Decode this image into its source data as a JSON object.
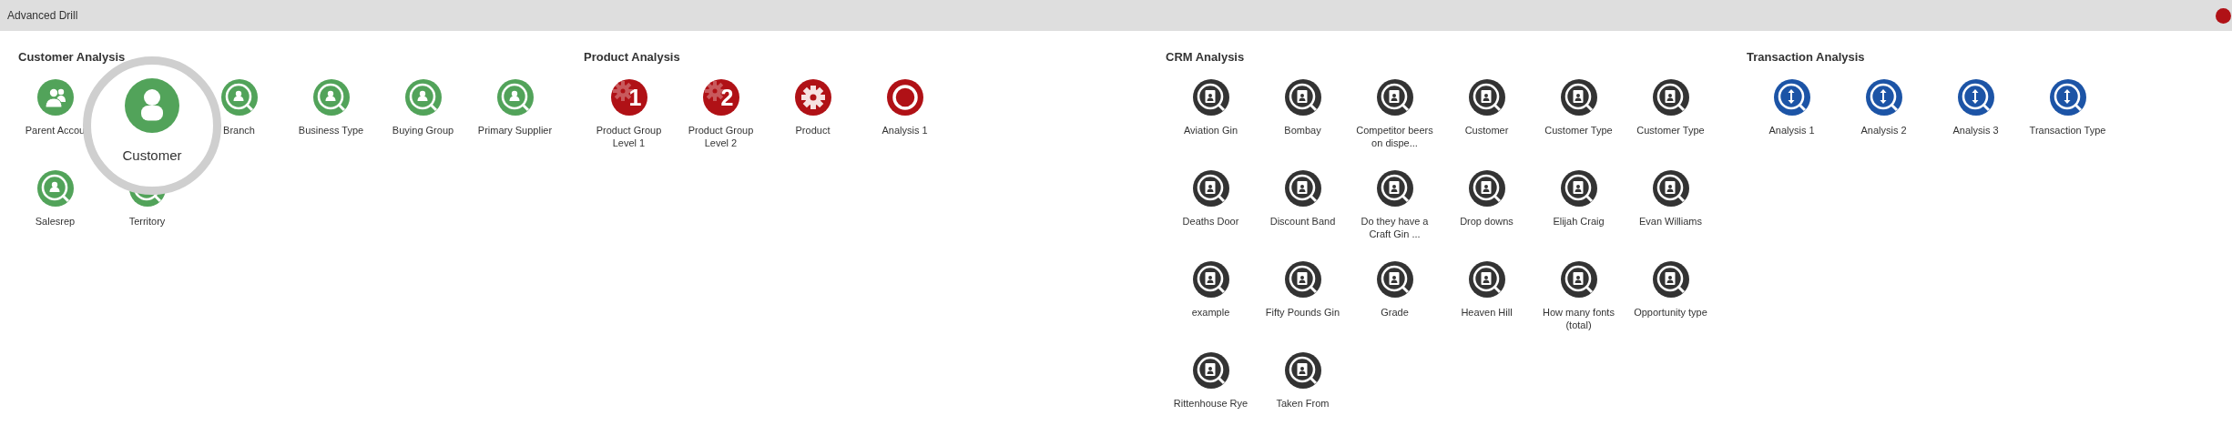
{
  "window": {
    "title": "Advanced Drill"
  },
  "sections": [
    {
      "title": "Customer Analysis",
      "color": "#52a35a",
      "items": [
        {
          "label": "Parent Accou",
          "kind": "group",
          "magnified": false
        },
        {
          "label": "Customer",
          "kind": "person",
          "magnified": true
        },
        {
          "label": "Branch",
          "kind": "person-search",
          "magnified": false
        },
        {
          "label": "Business Type",
          "kind": "person-search",
          "magnified": false
        },
        {
          "label": "Buying Group",
          "kind": "person-search",
          "magnified": false
        },
        {
          "label": "Primary Supplier",
          "kind": "person-search",
          "magnified": false
        },
        {
          "label": "Salesrep",
          "kind": "person-search",
          "magnified": false
        },
        {
          "label": "Territory",
          "kind": "person-search",
          "magnified": false
        }
      ]
    },
    {
      "title": "Product Analysis",
      "color": "#b01116",
      "items": [
        {
          "label": "Product Group Level 1",
          "kind": "gear-number",
          "number": "1",
          "magnified": false
        },
        {
          "label": "Product Group Level 2",
          "kind": "gear-number",
          "number": "2",
          "magnified": false
        },
        {
          "label": "Product",
          "kind": "gear",
          "magnified": false
        },
        {
          "label": "Analysis 1",
          "kind": "ring",
          "magnified": false
        }
      ]
    },
    {
      "title": "CRM Analysis",
      "color": "#333333",
      "items": [
        {
          "label": "Aviation Gin",
          "kind": "card-search",
          "magnified": false
        },
        {
          "label": "Bombay",
          "kind": "card-search",
          "magnified": false
        },
        {
          "label": "Competitor beers on dispe...",
          "kind": "card-search",
          "magnified": false
        },
        {
          "label": "Customer",
          "kind": "card-search",
          "magnified": false
        },
        {
          "label": "Customer Type",
          "kind": "card-search",
          "magnified": false
        },
        {
          "label": "Customer Type",
          "kind": "card-search",
          "magnified": false
        },
        {
          "label": "Deaths Door",
          "kind": "card-search",
          "magnified": false
        },
        {
          "label": "Discount Band",
          "kind": "card-search",
          "magnified": false
        },
        {
          "label": "Do they have a Craft Gin ...",
          "kind": "card-search",
          "magnified": false
        },
        {
          "label": "Drop downs",
          "kind": "card-search",
          "magnified": false
        },
        {
          "label": "Elijah Craig",
          "kind": "card-search",
          "magnified": false
        },
        {
          "label": "Evan Williams",
          "kind": "card-search",
          "magnified": false
        },
        {
          "label": "example",
          "kind": "card-search",
          "magnified": false
        },
        {
          "label": "Fifty Pounds Gin",
          "kind": "card-search",
          "magnified": false
        },
        {
          "label": "Grade",
          "kind": "card-search",
          "magnified": false
        },
        {
          "label": "Heaven Hill",
          "kind": "card-search",
          "magnified": false
        },
        {
          "label": "How many fonts (total)",
          "kind": "card-search",
          "magnified": false
        },
        {
          "label": "Opportunity type",
          "kind": "card-search",
          "magnified": false
        },
        {
          "label": "Rittenhouse Rye",
          "kind": "card-search",
          "magnified": false
        },
        {
          "label": "Taken From",
          "kind": "card-search",
          "magnified": false
        }
      ]
    },
    {
      "title": "Transaction Analysis",
      "color": "#1c54a6",
      "items": [
        {
          "label": "Analysis 1",
          "kind": "arrows-search",
          "magnified": false
        },
        {
          "label": "Analysis 2",
          "kind": "arrows-search",
          "magnified": false
        },
        {
          "label": "Analysis 3",
          "kind": "arrows-search",
          "magnified": false
        },
        {
          "label": "Transaction Type",
          "kind": "arrows-search",
          "magnified": false
        }
      ]
    }
  ]
}
